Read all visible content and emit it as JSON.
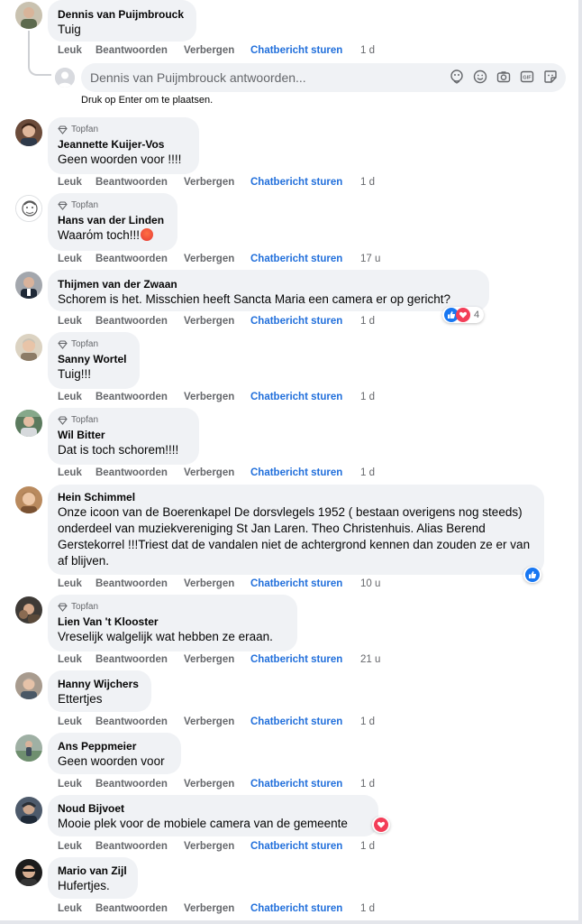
{
  "actions": {
    "like": "Leuk",
    "reply": "Beantwoorden",
    "hide": "Verbergen",
    "chat": "Chatbericht sturen"
  },
  "top_fan_label": "Topfan",
  "reply_input": {
    "placeholder": "Dennis van Puijmbrouck antwoorden...",
    "hint": "Druk op Enter om te plaatsen."
  },
  "comments": [
    {
      "author": "Dennis van Puijmbrouck",
      "text": "Tuig",
      "time": "1 d",
      "top_fan": false
    },
    {
      "author": "Jeannette Kuijer-Vos",
      "text": "Geen woorden voor !!!!",
      "time": "1 d",
      "top_fan": true
    },
    {
      "author": "Hans van der Linden",
      "text": "Waarόm toch!!!",
      "emoji": "angry-face-icon",
      "time": "17 u",
      "top_fan": true
    },
    {
      "author": "Thijmen van der Zwaan",
      "text": "Schorem is het. Misschien heeft Sancta Maria een camera er op gericht?",
      "time": "1 d",
      "top_fan": false,
      "reactions": {
        "icons": [
          "like-icon",
          "love-icon"
        ],
        "count": "4"
      }
    },
    {
      "author": "Sanny Wortel",
      "text": "Tuig!!!",
      "time": "1 d",
      "top_fan": true
    },
    {
      "author": "Wil Bitter",
      "text": "Dat is toch schorem!!!!",
      "time": "1 d",
      "top_fan": true
    },
    {
      "author": "Hein Schimmel",
      "text": "Onze icoon van de Boerenkapel De dorsvlegels 1952 ( bestaan overigens nog steeds) onderdeel van muziekvereniging St Jan Laren. Theo Christenhuis. Alias Berend Gerstekorrel !!!Triest dat de vandalen niet de achtergrond kennen dan zouden ze er van af blijven.",
      "time": "10 u",
      "top_fan": false,
      "reactions": {
        "icons": [
          "like-icon"
        ]
      }
    },
    {
      "author": "Lien Van 't Klooster",
      "text": "Vreselijk walgelijk wat hebben ze eraan.",
      "time": "21 u",
      "top_fan": true
    },
    {
      "author": "Hanny Wijchers",
      "text": "Ettertjes",
      "time": "1 d",
      "top_fan": false
    },
    {
      "author": "Ans Peppmeier",
      "text": "Geen woorden voor",
      "time": "1 d",
      "top_fan": false
    },
    {
      "author": "Noud Bijvoet",
      "text": "Mooie plek voor de mobiele camera van de gemeente",
      "time": "1 d",
      "top_fan": false,
      "reactions": {
        "icons": [
          "love-icon"
        ]
      }
    },
    {
      "author": "Mario van Zijl",
      "text": "Hufertjes.",
      "time": "1 d",
      "top_fan": false
    }
  ],
  "colors": {
    "bubble": "#f0f2f5",
    "link_blue": "#216fdb",
    "secondary_text": "#65676b",
    "like_blue": "#1877f2",
    "love_red": "#f33e58"
  }
}
